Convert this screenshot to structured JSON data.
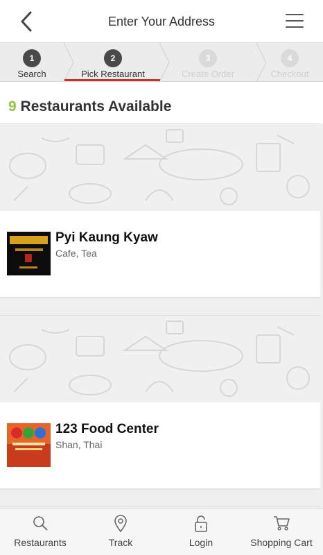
{
  "header": {
    "title": "Enter Your Address",
    "back_icon": "chevron-left-icon",
    "menu_icon": "hamburger-menu-icon"
  },
  "steps": [
    {
      "number": "1",
      "label": "Search",
      "state": "done"
    },
    {
      "number": "2",
      "label": "Pick Restaurant",
      "state": "current"
    },
    {
      "number": "3",
      "label": "Create Order",
      "state": "todo"
    },
    {
      "number": "4",
      "label": "Checkout",
      "state": "todo"
    }
  ],
  "results": {
    "count": "9",
    "label": "Restaurants Available",
    "count_color": "#8cc63f"
  },
  "restaurants": [
    {
      "name": "Pyi Kaung Kyaw",
      "cuisine": "Cafe, Tea"
    },
    {
      "name": "123 Food Center",
      "cuisine": "Shan, Thai"
    }
  ],
  "bottom_nav": [
    {
      "label": "Restaurants",
      "icon": "search-icon"
    },
    {
      "label": "Track",
      "icon": "map-pin-icon"
    },
    {
      "label": "Login",
      "icon": "lock-icon"
    },
    {
      "label": "Shopping Cart",
      "icon": "cart-icon"
    }
  ],
  "colors": {
    "accent": "#c8312f",
    "step_done": "#4a4a4a",
    "step_todo": "#dadada"
  }
}
